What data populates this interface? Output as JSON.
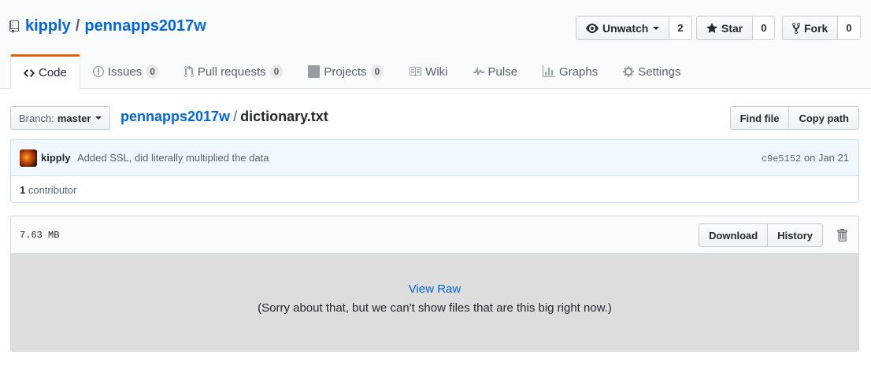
{
  "repo": {
    "owner": "kipply",
    "separator": "/",
    "name": "pennapps2017w"
  },
  "actions": {
    "watch_label": "Unwatch",
    "watch_count": "2",
    "star_label": "Star",
    "star_count": "0",
    "fork_label": "Fork",
    "fork_count": "0"
  },
  "tabs": [
    {
      "label": "Code",
      "icon": "code-icon",
      "selected": true
    },
    {
      "label": "Issues",
      "icon": "issue-icon",
      "count": "0"
    },
    {
      "label": "Pull requests",
      "icon": "pull-request-icon",
      "count": "0"
    },
    {
      "label": "Projects",
      "icon": "project-icon",
      "count": "0"
    },
    {
      "label": "Wiki",
      "icon": "book-icon"
    },
    {
      "label": "Pulse",
      "icon": "pulse-icon"
    },
    {
      "label": "Graphs",
      "icon": "graph-icon"
    },
    {
      "label": "Settings",
      "icon": "gear-icon"
    }
  ],
  "branch": {
    "prefix": "Branch:",
    "name": "master"
  },
  "breadcrumb": {
    "repo": "pennapps2017w",
    "separator": "/",
    "file": "dictionary.txt"
  },
  "file_nav": {
    "find_file": "Find file",
    "copy_path": "Copy path"
  },
  "commit": {
    "author": "kipply",
    "message": "Added SSL, did literally multiplied the data",
    "sha": "c9e5152",
    "date_prefix": "on",
    "date": "Jan 21"
  },
  "contributors": {
    "count": "1",
    "label": "contributor"
  },
  "file": {
    "size": "7.63 MB",
    "download": "Download",
    "history": "History",
    "view_raw": "View Raw",
    "too_big_message": "(Sorry about that, but we can't show files that are this big right now.)"
  },
  "colors": {
    "link": "#0366d6",
    "selected_tab_accent": "#e36209",
    "commit_bg": "#f1f8ff",
    "commit_border": "#c8e1ff",
    "file_body_bg": "#dddddd"
  }
}
